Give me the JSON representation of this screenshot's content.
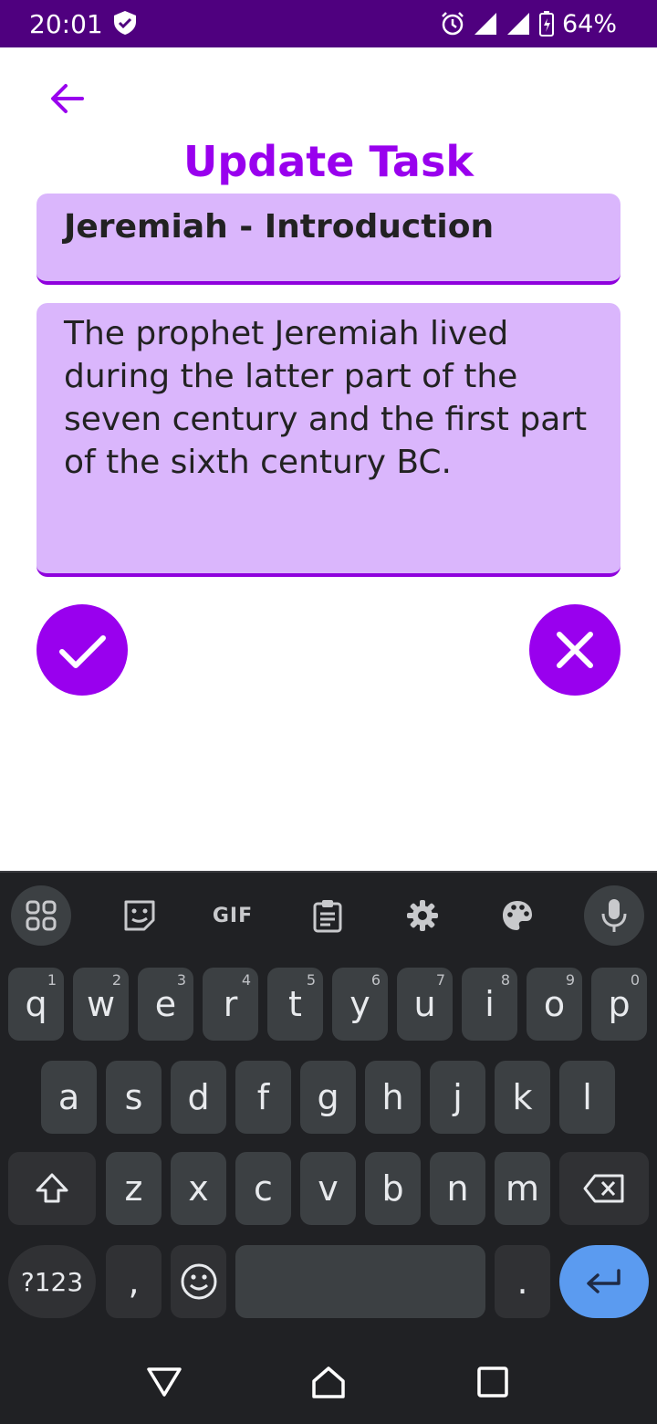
{
  "status_bar": {
    "time": "20:01",
    "battery": "64%",
    "icons": [
      "shield-icon",
      "alarm-icon",
      "signal-icon",
      "signal-icon",
      "battery-icon"
    ]
  },
  "header": {
    "back_icon": "arrow-left-icon",
    "title": "Update Task"
  },
  "form": {
    "title_value": "Jeremiah - Introduction",
    "body_value": "The prophet Jeremiah lived\nduring the latter part of the\nseven century and the first part\nof the sixth century BC."
  },
  "actions": {
    "confirm_icon": "check-icon",
    "cancel_icon": "close-icon"
  },
  "keyboard": {
    "toolbar": {
      "apps_icon": "grid-icon",
      "sticker_icon": "sticker-icon",
      "gif_label": "GIF",
      "clipboard_icon": "clipboard-icon",
      "settings_icon": "gear-icon",
      "theme_icon": "palette-icon",
      "mic_icon": "mic-icon"
    },
    "row1": [
      {
        "key": "q",
        "hint": "1"
      },
      {
        "key": "w",
        "hint": "2"
      },
      {
        "key": "e",
        "hint": "3"
      },
      {
        "key": "r",
        "hint": "4"
      },
      {
        "key": "t",
        "hint": "5"
      },
      {
        "key": "y",
        "hint": "6"
      },
      {
        "key": "u",
        "hint": "7"
      },
      {
        "key": "i",
        "hint": "8"
      },
      {
        "key": "o",
        "hint": "9"
      },
      {
        "key": "p",
        "hint": "0"
      }
    ],
    "row2": [
      "a",
      "s",
      "d",
      "f",
      "g",
      "h",
      "j",
      "k",
      "l"
    ],
    "row3": [
      "z",
      "x",
      "c",
      "v",
      "b",
      "n",
      "m"
    ],
    "row4": {
      "symbols": "?123",
      "comma": ",",
      "period": "."
    }
  },
  "nav_bar": {
    "icons": [
      "back-triangle-icon",
      "home-icon",
      "recents-icon"
    ]
  },
  "colors": {
    "accent": "#9900ee",
    "status_bar": "#4f007f",
    "field_bg": "#dab6fc",
    "keyboard_bg": "#202124",
    "enter_key": "#5b9bf0"
  }
}
